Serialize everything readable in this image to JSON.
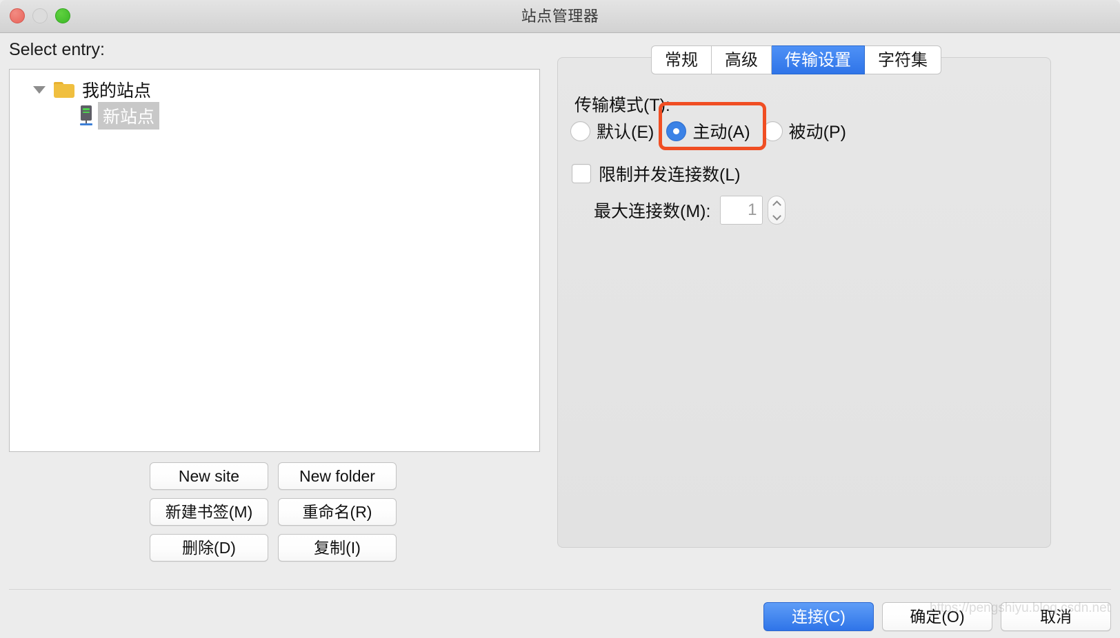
{
  "window": {
    "title": "站点管理器",
    "traffic_lights": [
      "close",
      "minimize",
      "maximize"
    ]
  },
  "left": {
    "select_entry_label": "Select entry:",
    "tree": {
      "root": {
        "label": "我的站点",
        "icon": "folder-icon",
        "expanded": true
      },
      "children": [
        {
          "label": "新站点",
          "icon": "server-icon",
          "selected": true
        }
      ]
    },
    "buttons": [
      {
        "label": "New site"
      },
      {
        "label": "New folder"
      },
      {
        "label": "新建书签(M)"
      },
      {
        "label": "重命名(R)"
      },
      {
        "label": "删除(D)"
      },
      {
        "label": "复制(I)"
      }
    ]
  },
  "right": {
    "tabs": [
      {
        "label": "常规",
        "active": false
      },
      {
        "label": "高级",
        "active": false
      },
      {
        "label": "传输设置",
        "active": true
      },
      {
        "label": "字符集",
        "active": false
      }
    ],
    "transfer_mode": {
      "group_label": "传输模式(T):",
      "options": [
        {
          "label": "默认(E)",
          "checked": false
        },
        {
          "label": "主动(A)",
          "checked": true,
          "highlighted": true
        },
        {
          "label": "被动(P)",
          "checked": false
        }
      ]
    },
    "limit_connections": {
      "label": "限制并发连接数(L)",
      "checked": false
    },
    "max_connections": {
      "label": "最大连接数(M):",
      "value": "1",
      "enabled": false
    }
  },
  "footer": {
    "buttons": [
      {
        "label": "连接(C)",
        "primary": true
      },
      {
        "label": "确定(O)",
        "primary": false
      },
      {
        "label": "取消",
        "primary": false
      }
    ]
  },
  "watermark": "https://pengshiyu.blog.csdn.net",
  "colors": {
    "accent_blue": "#2f74e8",
    "highlight_orange": "#f04e23",
    "folder_yellow": "#f0bf3f",
    "window_bg": "#ececec",
    "panel_bg": "#e4e4e4"
  }
}
